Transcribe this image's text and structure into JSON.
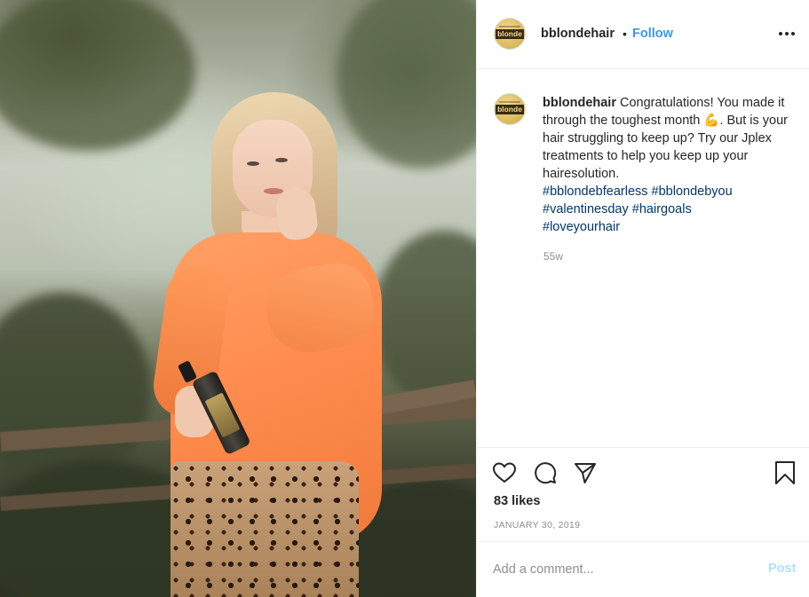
{
  "post": {
    "username": "bblondehair",
    "follow_separator": "•",
    "follow_label": "Follow",
    "avatar_brand": "blonde",
    "more_icon": "more-options-icon"
  },
  "caption": {
    "username": "bblondehair",
    "text_before_emoji": "Congratulations! You made it through the toughest month ",
    "emoji": "💪",
    "text_after_emoji": ". But is your hair struggling to keep up? Try our Jplex treatments to help you keep up your hairesolution.",
    "hashtags": [
      "#bblondebfearless",
      "#bblondebyou",
      "#valentinesday",
      "#hairgoals",
      "#loveyourhair"
    ],
    "time_ago": "55w"
  },
  "actions": {
    "icons": [
      "heart-icon",
      "comment-icon",
      "share-icon",
      "bookmark-icon"
    ]
  },
  "likes_label": "83 likes",
  "date_label": "JANUARY 30, 2019",
  "comment": {
    "placeholder": "Add a comment...",
    "post_label": "Post"
  },
  "colors": {
    "link_blue": "#3897f0",
    "hashtag_blue": "#00376b",
    "post_disabled": "#b2dffc",
    "sweater_orange": "#ff8c4e"
  }
}
